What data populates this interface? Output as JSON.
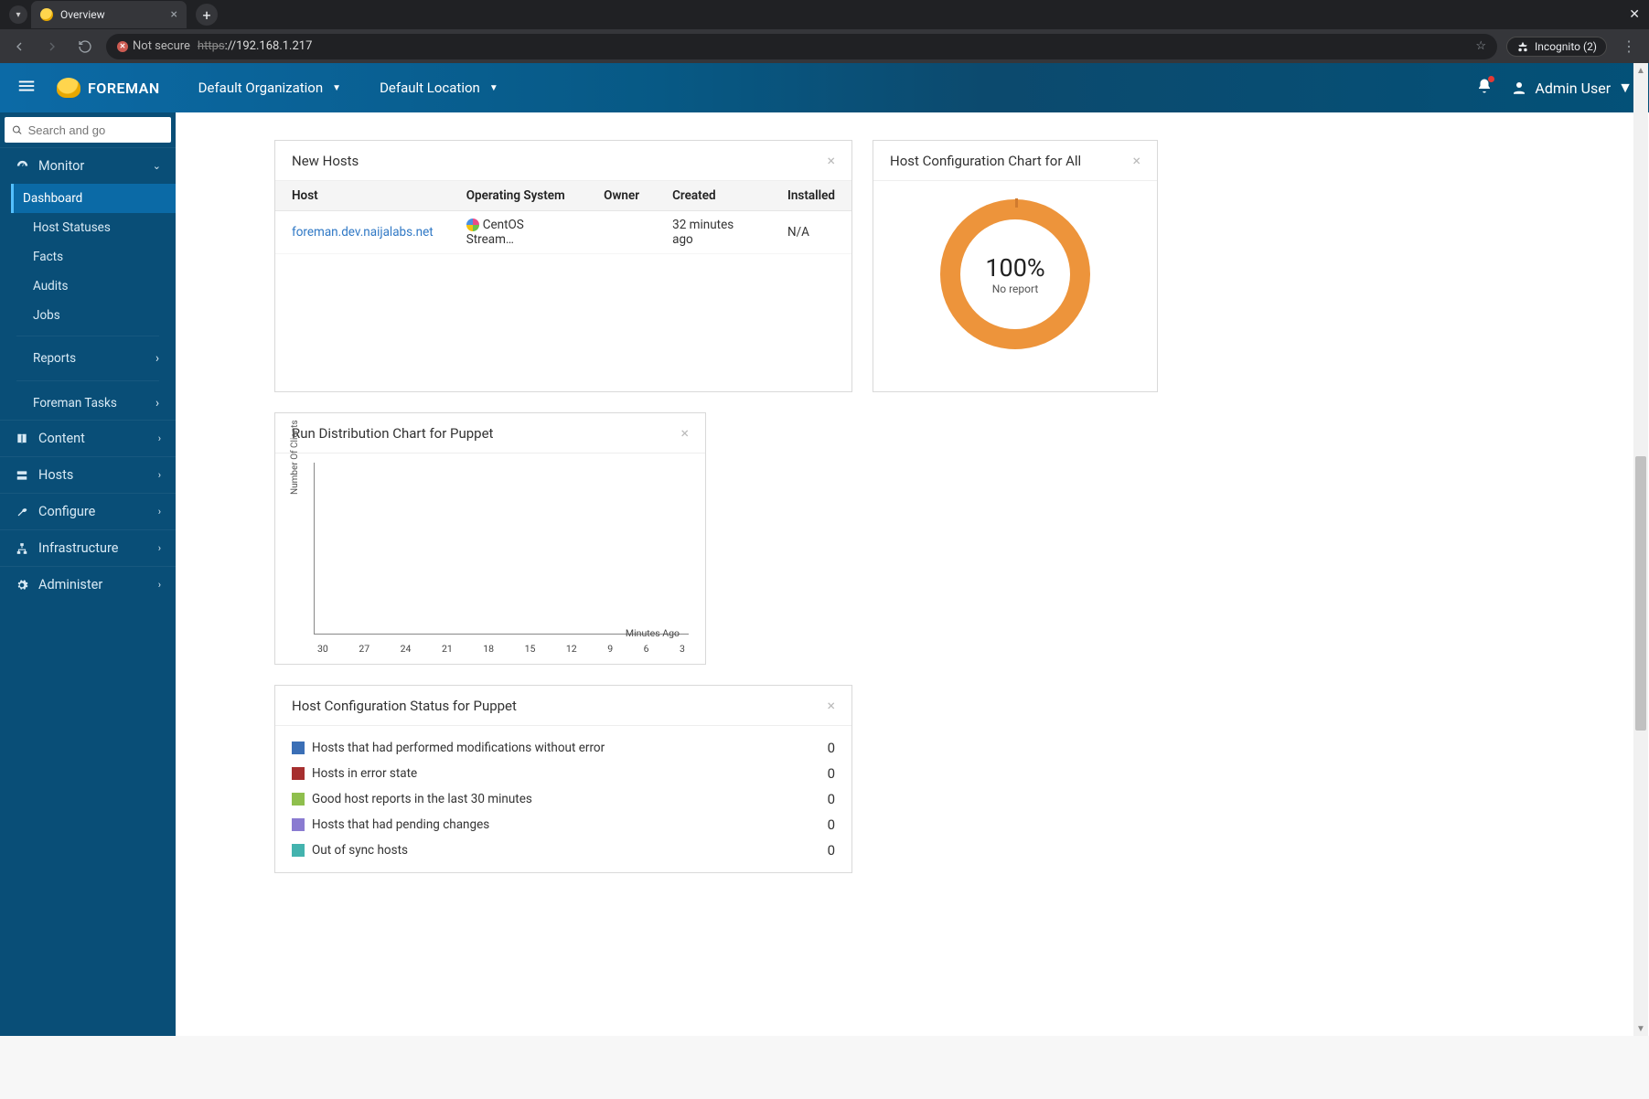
{
  "browser": {
    "tab_title": "Overview",
    "not_secure": "Not secure",
    "url_scheme": "https",
    "url_rest": "://192.168.1.217",
    "incognito": "Incognito (2)"
  },
  "topbar": {
    "brand": "FOREMAN",
    "org_label": "Default Organization",
    "loc_label": "Default Location",
    "user_label": "Admin User"
  },
  "sidebar": {
    "search_placeholder": "Search and go",
    "monitor": "Monitor",
    "monitor_items": {
      "dashboard": "Dashboard",
      "host_statuses": "Host Statuses",
      "facts": "Facts",
      "audits": "Audits",
      "jobs": "Jobs",
      "reports": "Reports",
      "foreman_tasks": "Foreman Tasks"
    },
    "content": "Content",
    "hosts": "Hosts",
    "configure": "Configure",
    "infrastructure": "Infrastructure",
    "administer": "Administer"
  },
  "new_hosts": {
    "title": "New Hosts",
    "columns": {
      "host": "Host",
      "os": "Operating System",
      "owner": "Owner",
      "created": "Created",
      "installed": "Installed"
    },
    "rows": [
      {
        "host": "foreman.dev.naijalabs.net",
        "os": "CentOS Stream…",
        "owner": "",
        "created": "32 minutes ago",
        "installed": "N/A"
      }
    ]
  },
  "host_config_chart": {
    "title": "Host Configuration Chart for All",
    "percent": "100%",
    "label": "No report"
  },
  "run_dist": {
    "title": "Run Distribution Chart for Puppet",
    "y_label": "Number Of Clients",
    "x_label": "Minutes Ago",
    "x_ticks": [
      "30",
      "27",
      "24",
      "21",
      "18",
      "15",
      "12",
      "9",
      "6",
      "3"
    ]
  },
  "host_config_status": {
    "title": "Host Configuration Status for Puppet",
    "rows": [
      {
        "color": "#3b6fb6",
        "label": "Hosts that had performed modifications without error",
        "count": "0"
      },
      {
        "color": "#a62f2f",
        "label": "Hosts in error state",
        "count": "0"
      },
      {
        "color": "#8fbf4d",
        "label": "Good host reports in the last 30 minutes",
        "count": "0"
      },
      {
        "color": "#8a7bd1",
        "label": "Hosts that had pending changes",
        "count": "0"
      },
      {
        "color": "#43b3ae",
        "label": "Out of sync hosts",
        "count": "0"
      }
    ]
  },
  "chart_data": [
    {
      "type": "pie",
      "title": "Host Configuration Chart for All",
      "series": [
        {
          "name": "No report",
          "values": [
            100
          ]
        }
      ],
      "categories": [
        "No report"
      ],
      "colors": [
        "#ed943b"
      ]
    },
    {
      "type": "bar",
      "title": "Run Distribution Chart for Puppet",
      "xlabel": "Minutes Ago",
      "ylabel": "Number Of Clients",
      "categories": [
        "30",
        "27",
        "24",
        "21",
        "18",
        "15",
        "12",
        "9",
        "6",
        "3"
      ],
      "values": [
        0,
        0,
        0,
        0,
        0,
        0,
        0,
        0,
        0,
        0
      ],
      "ylim": [
        0,
        1
      ]
    },
    {
      "type": "table",
      "title": "Host Configuration Status for Puppet",
      "categories": [
        "Hosts that had performed modifications without error",
        "Hosts in error state",
        "Good host reports in the last 30 minutes",
        "Hosts that had pending changes",
        "Out of sync hosts"
      ],
      "values": [
        0,
        0,
        0,
        0,
        0
      ]
    }
  ]
}
